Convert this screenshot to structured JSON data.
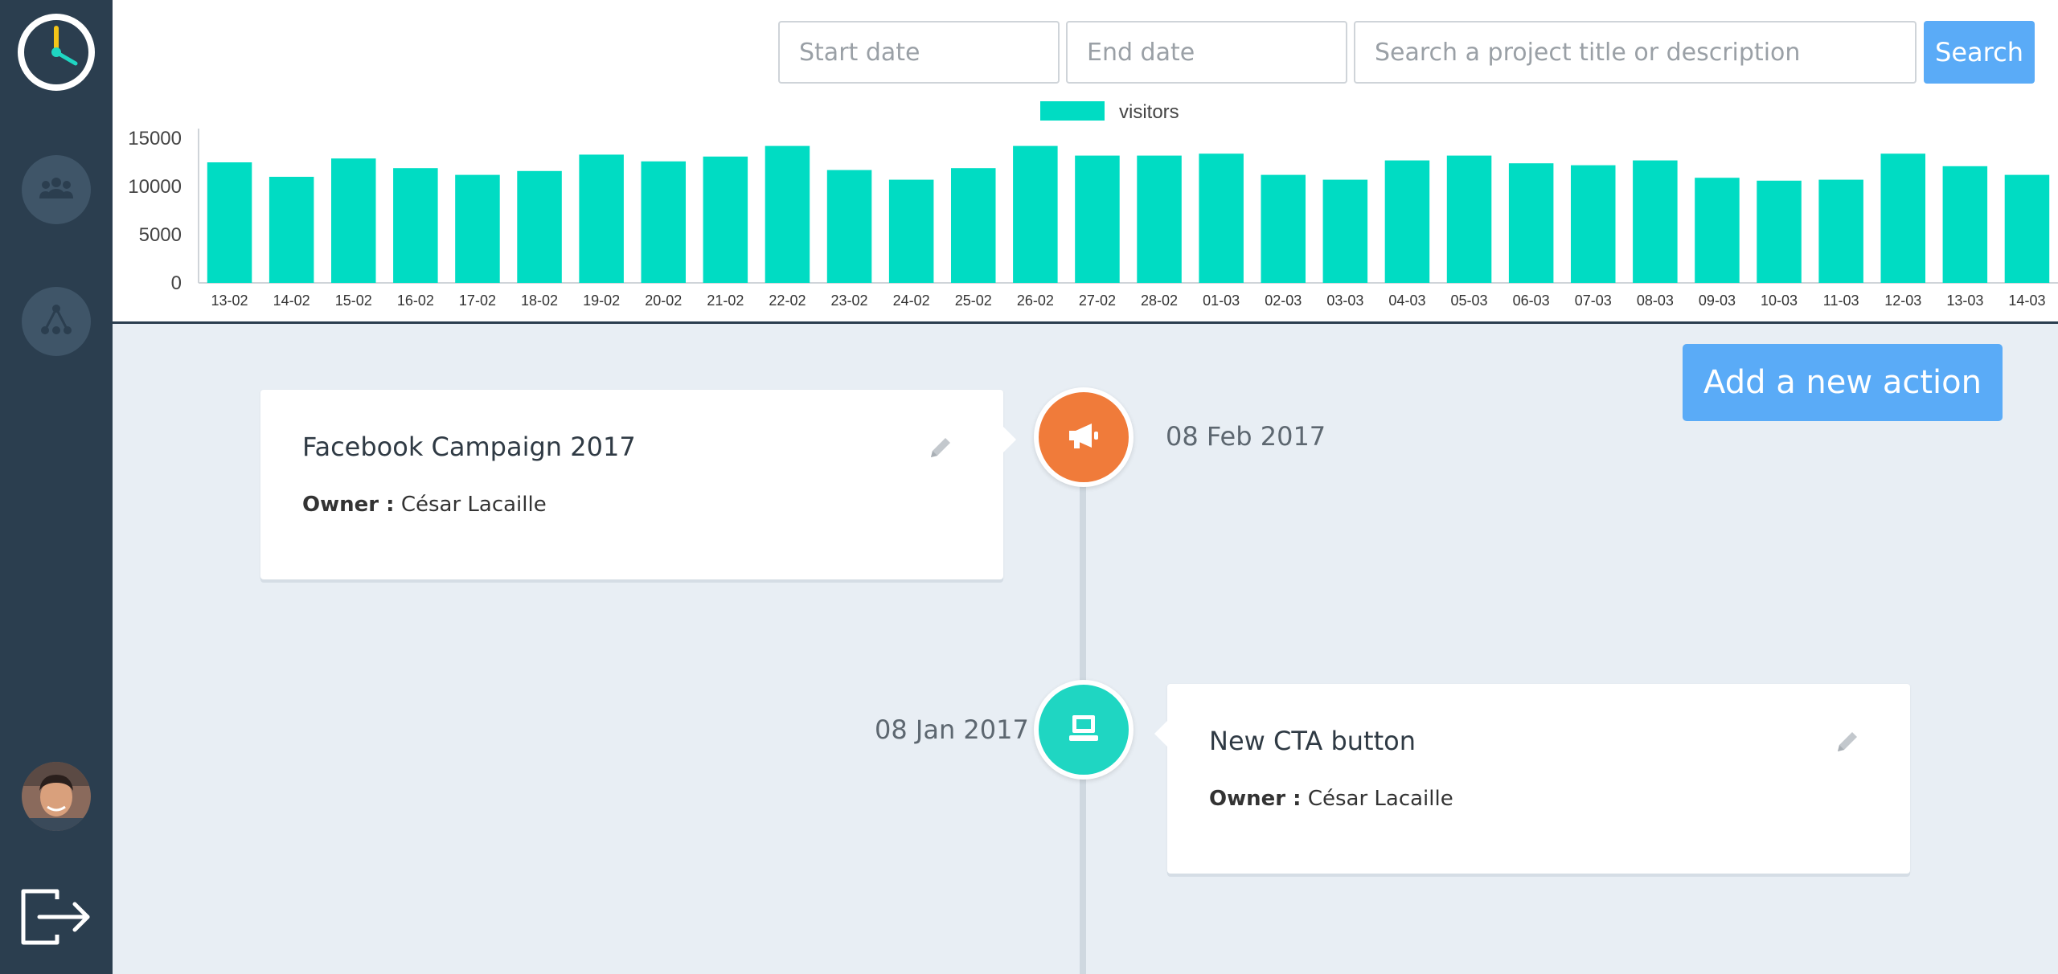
{
  "sidebar": {
    "items": [
      {
        "icon": "team-icon"
      },
      {
        "icon": "hierarchy-icon"
      }
    ],
    "avatar": "user-avatar",
    "logout_icon": "logout-icon"
  },
  "filters": {
    "start_placeholder": "Start date",
    "end_placeholder": "End date",
    "search_placeholder": "Search a project title or description",
    "search_label": "Search"
  },
  "chart_data": {
    "type": "bar",
    "legend": "visitors",
    "color": "#00dcc3",
    "ylim": [
      0,
      15000
    ],
    "yticks": [
      0,
      5000,
      10000,
      15000
    ],
    "categories": [
      "13-02",
      "14-02",
      "15-02",
      "16-02",
      "17-02",
      "18-02",
      "19-02",
      "20-02",
      "21-02",
      "22-02",
      "23-02",
      "24-02",
      "25-02",
      "26-02",
      "27-02",
      "28-02",
      "01-03",
      "02-03",
      "03-03",
      "04-03",
      "05-03",
      "06-03",
      "07-03",
      "08-03",
      "09-03",
      "10-03",
      "11-03",
      "12-03",
      "13-03",
      "14-03"
    ],
    "series": [
      {
        "name": "visitors",
        "values": [
          12500,
          11000,
          12900,
          11900,
          11200,
          11600,
          13300,
          12600,
          13100,
          14200,
          11700,
          10700,
          11900,
          14200,
          13200,
          13200,
          13400,
          11200,
          10700,
          12700,
          13200,
          12400,
          12200,
          12700,
          10900,
          10600,
          10700,
          13400,
          12100,
          11200
        ]
      }
    ]
  },
  "actions": {
    "add_label": "Add a new action"
  },
  "timeline": [
    {
      "title": "Facebook Campaign 2017",
      "owner_label": "Owner :",
      "owner": "César Lacaille",
      "date": "08 Feb 2017",
      "icon": "megaphone-icon",
      "color": "#f07b3a"
    },
    {
      "title": "New CTA button",
      "owner_label": "Owner :",
      "owner": "César Lacaille",
      "date": "08 Jan 2017",
      "icon": "computer-icon",
      "color": "#1fd6c2"
    }
  ],
  "colors": {
    "sidebar": "#2b3e4f",
    "accent": "#5aabf7",
    "bar": "#00dcc3",
    "background": "#e8eef4"
  }
}
